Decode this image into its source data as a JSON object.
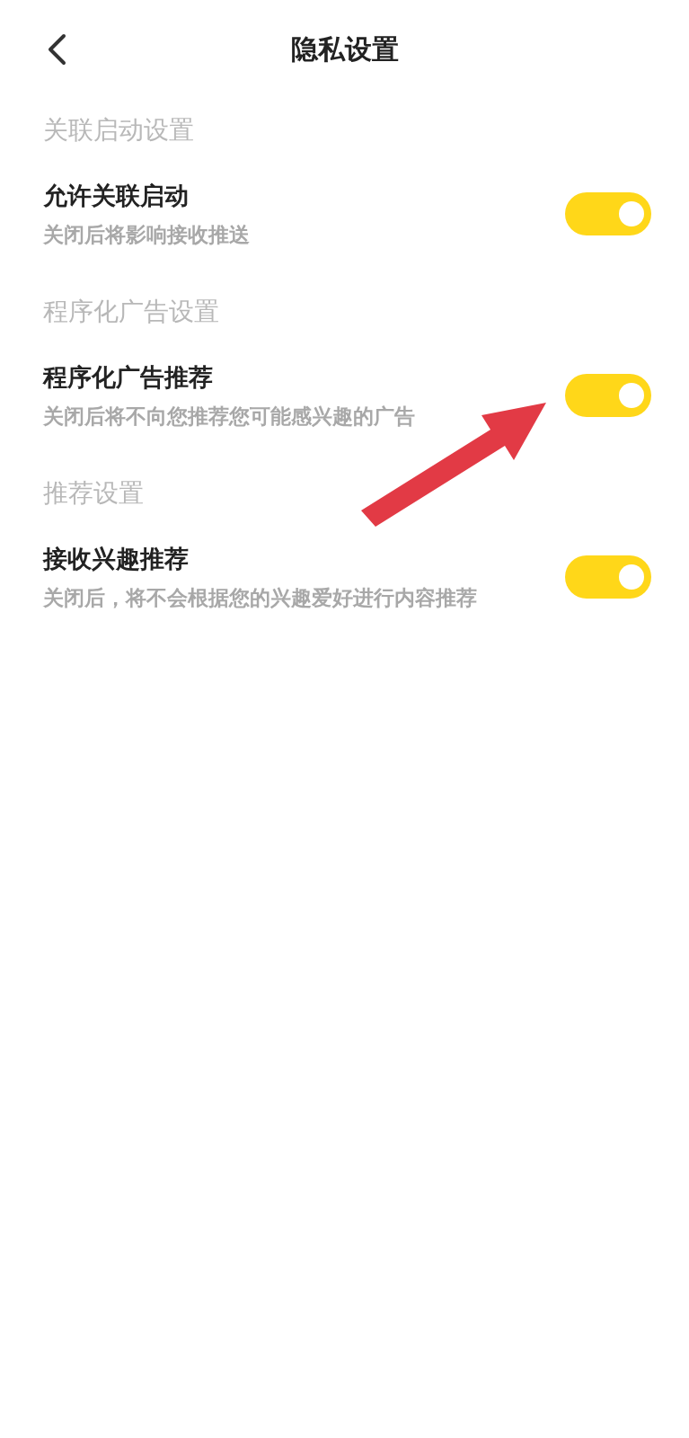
{
  "header": {
    "title": "隐私设置"
  },
  "sections": [
    {
      "label": "关联启动设置",
      "item": {
        "title": "允许关联启动",
        "subtitle": "关闭后将影响接收推送",
        "on": true
      }
    },
    {
      "label": "程序化广告设置",
      "item": {
        "title": "程序化广告推荐",
        "subtitle": "关闭后将不向您推荐您可能感兴趣的广告",
        "on": true
      }
    },
    {
      "label": "推荐设置",
      "item": {
        "title": "接收兴趣推荐",
        "subtitle": "关闭后，将不会根据您的兴趣爱好进行内容推荐",
        "on": true
      }
    }
  ]
}
